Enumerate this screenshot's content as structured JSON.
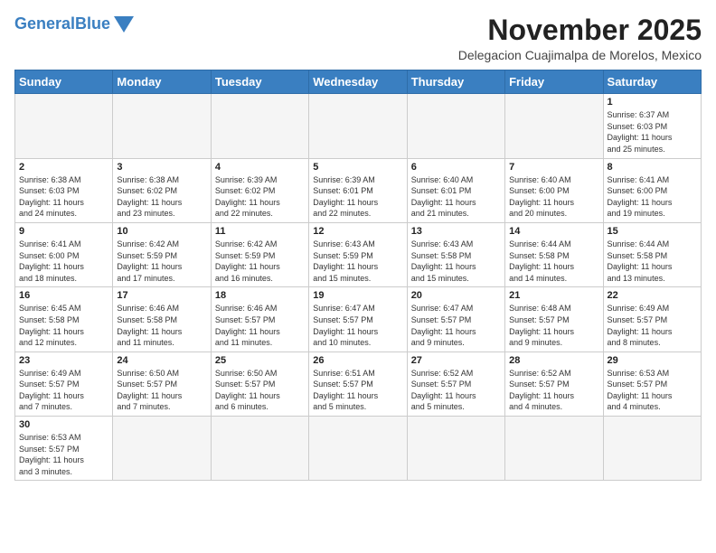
{
  "header": {
    "logo_general": "General",
    "logo_blue": "Blue",
    "month_title": "November 2025",
    "subtitle": "Delegacion Cuajimalpa de Morelos, Mexico"
  },
  "days_of_week": [
    "Sunday",
    "Monday",
    "Tuesday",
    "Wednesday",
    "Thursday",
    "Friday",
    "Saturday"
  ],
  "weeks": [
    [
      {
        "day": "",
        "info": ""
      },
      {
        "day": "",
        "info": ""
      },
      {
        "day": "",
        "info": ""
      },
      {
        "day": "",
        "info": ""
      },
      {
        "day": "",
        "info": ""
      },
      {
        "day": "",
        "info": ""
      },
      {
        "day": "1",
        "info": "Sunrise: 6:37 AM\nSunset: 6:03 PM\nDaylight: 11 hours\nand 25 minutes."
      }
    ],
    [
      {
        "day": "2",
        "info": "Sunrise: 6:38 AM\nSunset: 6:03 PM\nDaylight: 11 hours\nand 24 minutes."
      },
      {
        "day": "3",
        "info": "Sunrise: 6:38 AM\nSunset: 6:02 PM\nDaylight: 11 hours\nand 23 minutes."
      },
      {
        "day": "4",
        "info": "Sunrise: 6:39 AM\nSunset: 6:02 PM\nDaylight: 11 hours\nand 22 minutes."
      },
      {
        "day": "5",
        "info": "Sunrise: 6:39 AM\nSunset: 6:01 PM\nDaylight: 11 hours\nand 22 minutes."
      },
      {
        "day": "6",
        "info": "Sunrise: 6:40 AM\nSunset: 6:01 PM\nDaylight: 11 hours\nand 21 minutes."
      },
      {
        "day": "7",
        "info": "Sunrise: 6:40 AM\nSunset: 6:00 PM\nDaylight: 11 hours\nand 20 minutes."
      },
      {
        "day": "8",
        "info": "Sunrise: 6:41 AM\nSunset: 6:00 PM\nDaylight: 11 hours\nand 19 minutes."
      }
    ],
    [
      {
        "day": "9",
        "info": "Sunrise: 6:41 AM\nSunset: 6:00 PM\nDaylight: 11 hours\nand 18 minutes."
      },
      {
        "day": "10",
        "info": "Sunrise: 6:42 AM\nSunset: 5:59 PM\nDaylight: 11 hours\nand 17 minutes."
      },
      {
        "day": "11",
        "info": "Sunrise: 6:42 AM\nSunset: 5:59 PM\nDaylight: 11 hours\nand 16 minutes."
      },
      {
        "day": "12",
        "info": "Sunrise: 6:43 AM\nSunset: 5:59 PM\nDaylight: 11 hours\nand 15 minutes."
      },
      {
        "day": "13",
        "info": "Sunrise: 6:43 AM\nSunset: 5:58 PM\nDaylight: 11 hours\nand 15 minutes."
      },
      {
        "day": "14",
        "info": "Sunrise: 6:44 AM\nSunset: 5:58 PM\nDaylight: 11 hours\nand 14 minutes."
      },
      {
        "day": "15",
        "info": "Sunrise: 6:44 AM\nSunset: 5:58 PM\nDaylight: 11 hours\nand 13 minutes."
      }
    ],
    [
      {
        "day": "16",
        "info": "Sunrise: 6:45 AM\nSunset: 5:58 PM\nDaylight: 11 hours\nand 12 minutes."
      },
      {
        "day": "17",
        "info": "Sunrise: 6:46 AM\nSunset: 5:58 PM\nDaylight: 11 hours\nand 11 minutes."
      },
      {
        "day": "18",
        "info": "Sunrise: 6:46 AM\nSunset: 5:57 PM\nDaylight: 11 hours\nand 11 minutes."
      },
      {
        "day": "19",
        "info": "Sunrise: 6:47 AM\nSunset: 5:57 PM\nDaylight: 11 hours\nand 10 minutes."
      },
      {
        "day": "20",
        "info": "Sunrise: 6:47 AM\nSunset: 5:57 PM\nDaylight: 11 hours\nand 9 minutes."
      },
      {
        "day": "21",
        "info": "Sunrise: 6:48 AM\nSunset: 5:57 PM\nDaylight: 11 hours\nand 9 minutes."
      },
      {
        "day": "22",
        "info": "Sunrise: 6:49 AM\nSunset: 5:57 PM\nDaylight: 11 hours\nand 8 minutes."
      }
    ],
    [
      {
        "day": "23",
        "info": "Sunrise: 6:49 AM\nSunset: 5:57 PM\nDaylight: 11 hours\nand 7 minutes."
      },
      {
        "day": "24",
        "info": "Sunrise: 6:50 AM\nSunset: 5:57 PM\nDaylight: 11 hours\nand 7 minutes."
      },
      {
        "day": "25",
        "info": "Sunrise: 6:50 AM\nSunset: 5:57 PM\nDaylight: 11 hours\nand 6 minutes."
      },
      {
        "day": "26",
        "info": "Sunrise: 6:51 AM\nSunset: 5:57 PM\nDaylight: 11 hours\nand 5 minutes."
      },
      {
        "day": "27",
        "info": "Sunrise: 6:52 AM\nSunset: 5:57 PM\nDaylight: 11 hours\nand 5 minutes."
      },
      {
        "day": "28",
        "info": "Sunrise: 6:52 AM\nSunset: 5:57 PM\nDaylight: 11 hours\nand 4 minutes."
      },
      {
        "day": "29",
        "info": "Sunrise: 6:53 AM\nSunset: 5:57 PM\nDaylight: 11 hours\nand 4 minutes."
      }
    ],
    [
      {
        "day": "30",
        "info": "Sunrise: 6:53 AM\nSunset: 5:57 PM\nDaylight: 11 hours\nand 3 minutes."
      },
      {
        "day": "",
        "info": ""
      },
      {
        "day": "",
        "info": ""
      },
      {
        "day": "",
        "info": ""
      },
      {
        "day": "",
        "info": ""
      },
      {
        "day": "",
        "info": ""
      },
      {
        "day": "",
        "info": ""
      }
    ]
  ]
}
